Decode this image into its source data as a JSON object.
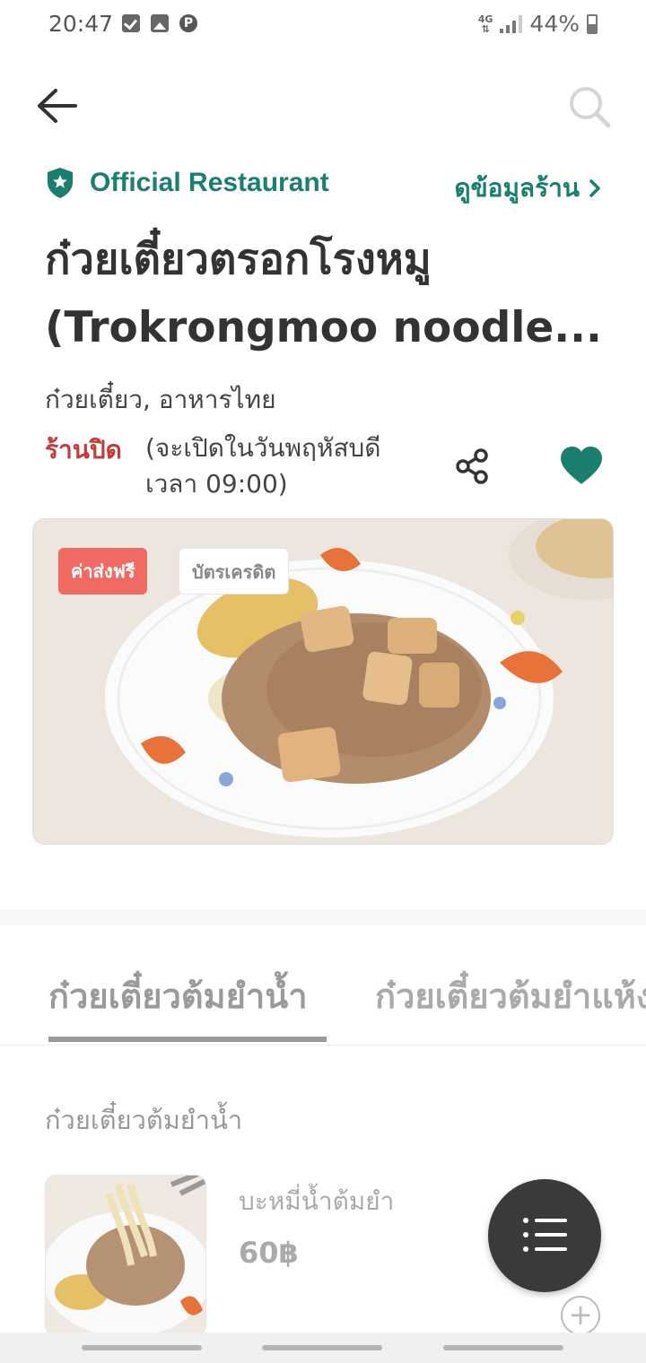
{
  "status_bar": {
    "time": "20:47",
    "network": "4G",
    "battery": "44%",
    "left_icons": [
      "check-icon",
      "image-icon",
      "parking-icon"
    ]
  },
  "nav": {
    "back_icon": "arrow-left-icon",
    "search_icon": "search-icon"
  },
  "restaurant": {
    "official_label": "Official Restaurant",
    "official_icon": "shield-star-icon",
    "info_link": "ดูข้อมูลร้าน",
    "title_line1": "ก๋วยเตี๋ยวตรอกโรงหมู",
    "title_line2": "(Trokrongmoo noodle...",
    "cuisine": "ก๋วยเตี๋ยว, อาหารไทย",
    "status": "ร้านปิด",
    "reopen": "(จะเปิดในวันพฤหัสบดี เวลา 09:00)",
    "favorited": true
  },
  "hero": {
    "badges": [
      "ค่าส่งฟรี",
      "บัตรเครดิต"
    ]
  },
  "tabs": [
    {
      "label": "ก๋วยเตี๋ยวต้มยำน้ำ",
      "active": true
    },
    {
      "label": "ก๋วยเตี๋ยวต้มยำแห้ง",
      "active": false
    }
  ],
  "menu": {
    "section_title": "ก๋วยเตี๋ยวต้มยำน้ำ",
    "items": [
      {
        "name": "บะหมี่น้ำต้มยำ",
        "price": "60฿"
      }
    ]
  },
  "colors": {
    "brand_green": "#1a7f6e",
    "closed_red": "#c33b3b",
    "badge_red": "#ef6a63"
  }
}
